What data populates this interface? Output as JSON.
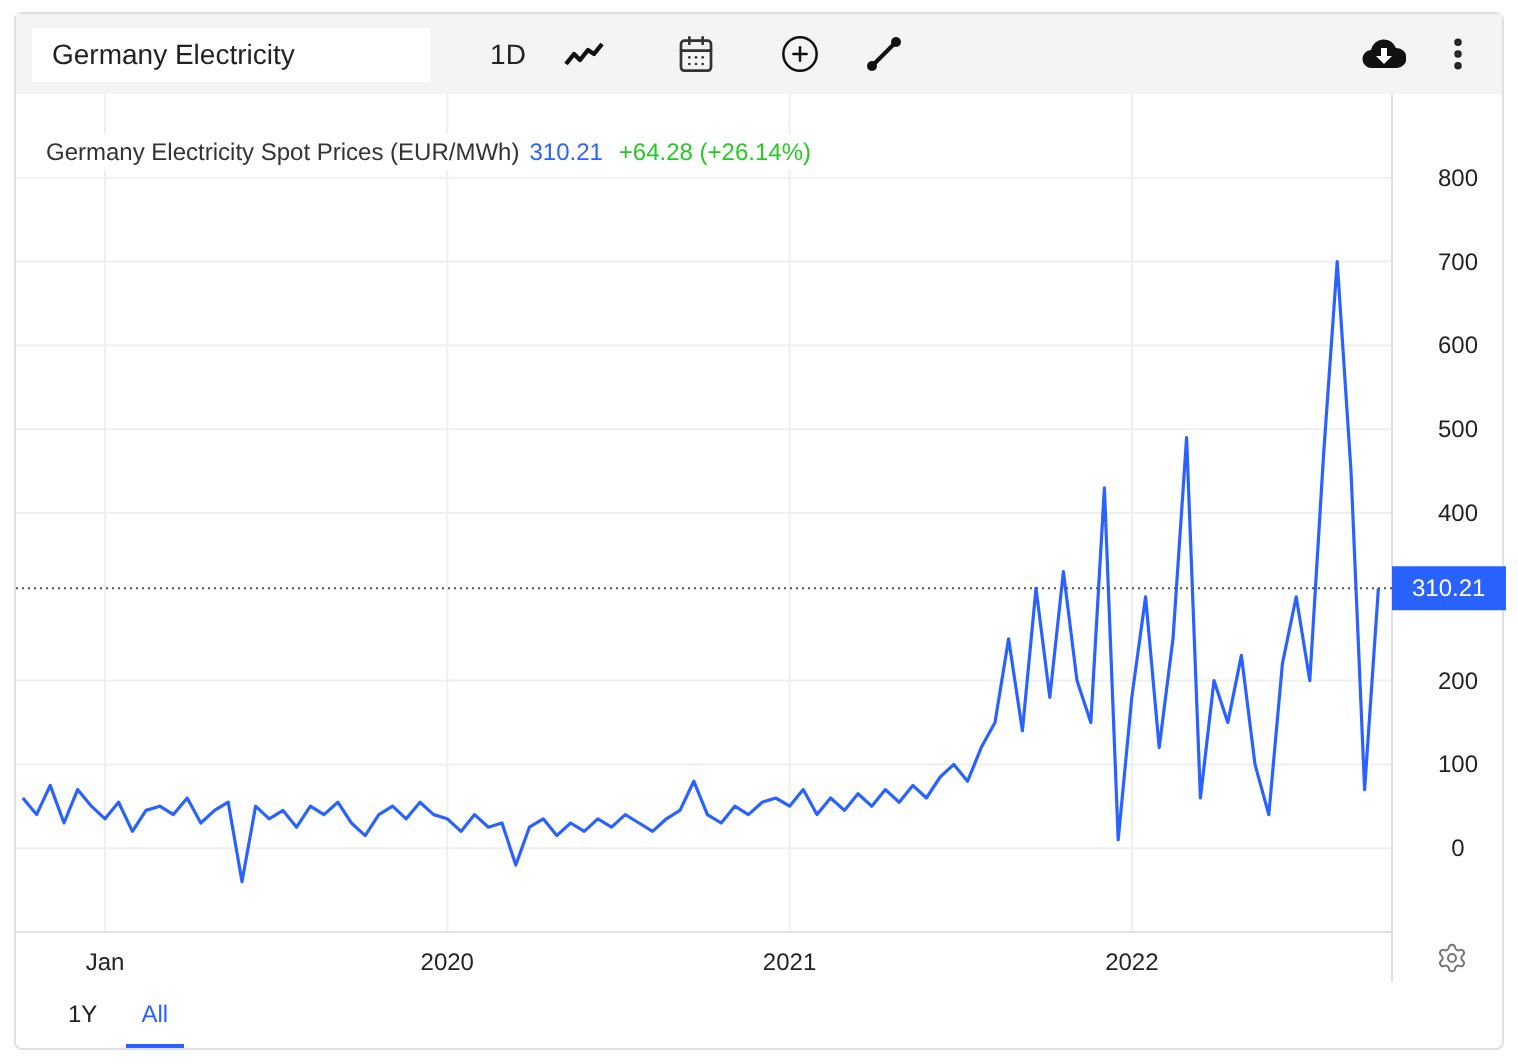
{
  "toolbar": {
    "search": {
      "value": "Germany Electricity"
    },
    "interval": "1D"
  },
  "legend": {
    "name": "Germany Electricity Spot Prices (EUR/MWh)",
    "price": "310.21",
    "change": "+64.28 (+26.14%)"
  },
  "chart_data": {
    "type": "line",
    "xlim": [
      2018.74,
      2022.76
    ],
    "ylim": [
      -100,
      900
    ],
    "xticks": [
      {
        "value": 2019,
        "label": "Jan"
      },
      {
        "value": 2020,
        "label": "2020"
      },
      {
        "value": 2021,
        "label": "2021"
      },
      {
        "value": 2022,
        "label": "2022"
      }
    ],
    "yticks": [
      0,
      100,
      200,
      400,
      500,
      600,
      700,
      800
    ],
    "grid": true,
    "x": [
      2018.76,
      2018.8,
      2018.84,
      2018.88,
      2018.92,
      2018.96,
      2019,
      2019.04,
      2019.08,
      2019.12,
      2019.16,
      2019.2,
      2019.24,
      2019.28,
      2019.32,
      2019.36,
      2019.4,
      2019.44,
      2019.48,
      2019.52,
      2019.56,
      2019.6,
      2019.64,
      2019.68,
      2019.72,
      2019.76,
      2019.8,
      2019.84,
      2019.88,
      2019.92,
      2019.96,
      2020,
      2020.04,
      2020.08,
      2020.12,
      2020.16,
      2020.2,
      2020.24,
      2020.28,
      2020.32,
      2020.36,
      2020.4,
      2020.44,
      2020.48,
      2020.52,
      2020.56,
      2020.6,
      2020.64,
      2020.68,
      2020.72,
      2020.76,
      2020.8,
      2020.84,
      2020.88,
      2020.92,
      2020.96,
      2021,
      2021.04,
      2021.08,
      2021.12,
      2021.16,
      2021.2,
      2021.24,
      2021.28,
      2021.32,
      2021.36,
      2021.4,
      2021.44,
      2021.48,
      2021.52,
      2021.56,
      2021.6,
      2021.64,
      2021.68,
      2021.72,
      2021.76,
      2021.8,
      2021.84,
      2021.88,
      2021.92,
      2021.96,
      2022,
      2022.04,
      2022.08,
      2022.12,
      2022.16,
      2022.2,
      2022.24,
      2022.28,
      2022.32,
      2022.36,
      2022.4,
      2022.44,
      2022.48,
      2022.52,
      2022.56,
      2022.6,
      2022.64,
      2022.68,
      2022.72
    ],
    "series": [
      {
        "color": "#2962ff",
        "values": [
          60,
          40,
          75,
          30,
          70,
          50,
          35,
          55,
          20,
          45,
          50,
          40,
          60,
          30,
          45,
          55,
          -40,
          50,
          35,
          45,
          25,
          50,
          40,
          55,
          30,
          15,
          40,
          50,
          35,
          55,
          40,
          35,
          20,
          40,
          25,
          30,
          -20,
          25,
          35,
          15,
          30,
          20,
          35,
          25,
          40,
          30,
          20,
          35,
          45,
          80,
          40,
          30,
          50,
          40,
          55,
          60,
          50,
          70,
          40,
          60,
          45,
          65,
          50,
          70,
          55,
          75,
          60,
          85,
          100,
          80,
          120,
          150,
          250,
          140,
          310,
          180,
          330,
          200,
          150,
          430,
          10,
          180,
          300,
          120,
          250,
          490,
          60,
          200,
          150,
          230,
          100,
          40,
          220,
          300,
          200,
          470,
          700,
          450,
          70,
          310
        ]
      }
    ],
    "ref_lines": [
      {
        "axis": "y",
        "value": 310.21,
        "label": "310.21"
      }
    ]
  },
  "range_tabs": [
    {
      "label": "1Y",
      "selected": false
    },
    {
      "label": "All",
      "selected": true
    }
  ]
}
